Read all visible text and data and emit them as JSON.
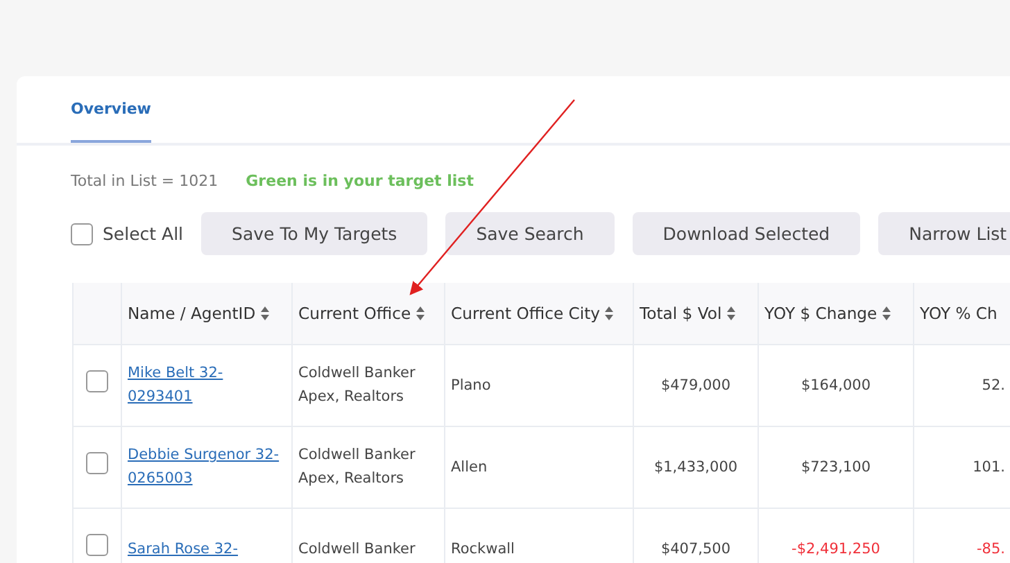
{
  "tabs": [
    {
      "label": "Overview",
      "selected": true
    }
  ],
  "summary": {
    "total": "Total in List = 1021",
    "note": "Green is in your target list"
  },
  "select_all": {
    "label": "Select All",
    "checked": false
  },
  "buttons": [
    "Save To My Targets",
    "Save Search",
    "Download Selected",
    "Narrow  List"
  ],
  "table": {
    "columns": [
      "Name / AgentID",
      "Current Office",
      "Current Office City",
      "Total $ Vol",
      "YOY $ Change",
      "YOY % Ch"
    ],
    "rows": [
      {
        "checked": false,
        "declined": false,
        "name": "Mike Belt 32-0293401",
        "office": "Coldwell Banker Apex, Realtors",
        "city": "Plano",
        "total": "$479,000",
        "yoy_change": "$164,000",
        "yoy_pct": "52."
      },
      {
        "checked": false,
        "declined": false,
        "name": "Debbie Surgenor 32-0265003",
        "office": "Coldwell Banker Apex, Realtors",
        "city": "Allen",
        "total": "$1,433,000",
        "yoy_change": "$723,100",
        "yoy_pct": "101."
      },
      {
        "checked": false,
        "declined": true,
        "name": "Sarah Rose 32-",
        "office": "Coldwell Banker",
        "city": "Rockwall",
        "total": "$407,500",
        "yoy_change": "-$2,491,250",
        "yoy_pct": "-85."
      }
    ]
  },
  "annotation": {
    "kind": "arrow"
  }
}
